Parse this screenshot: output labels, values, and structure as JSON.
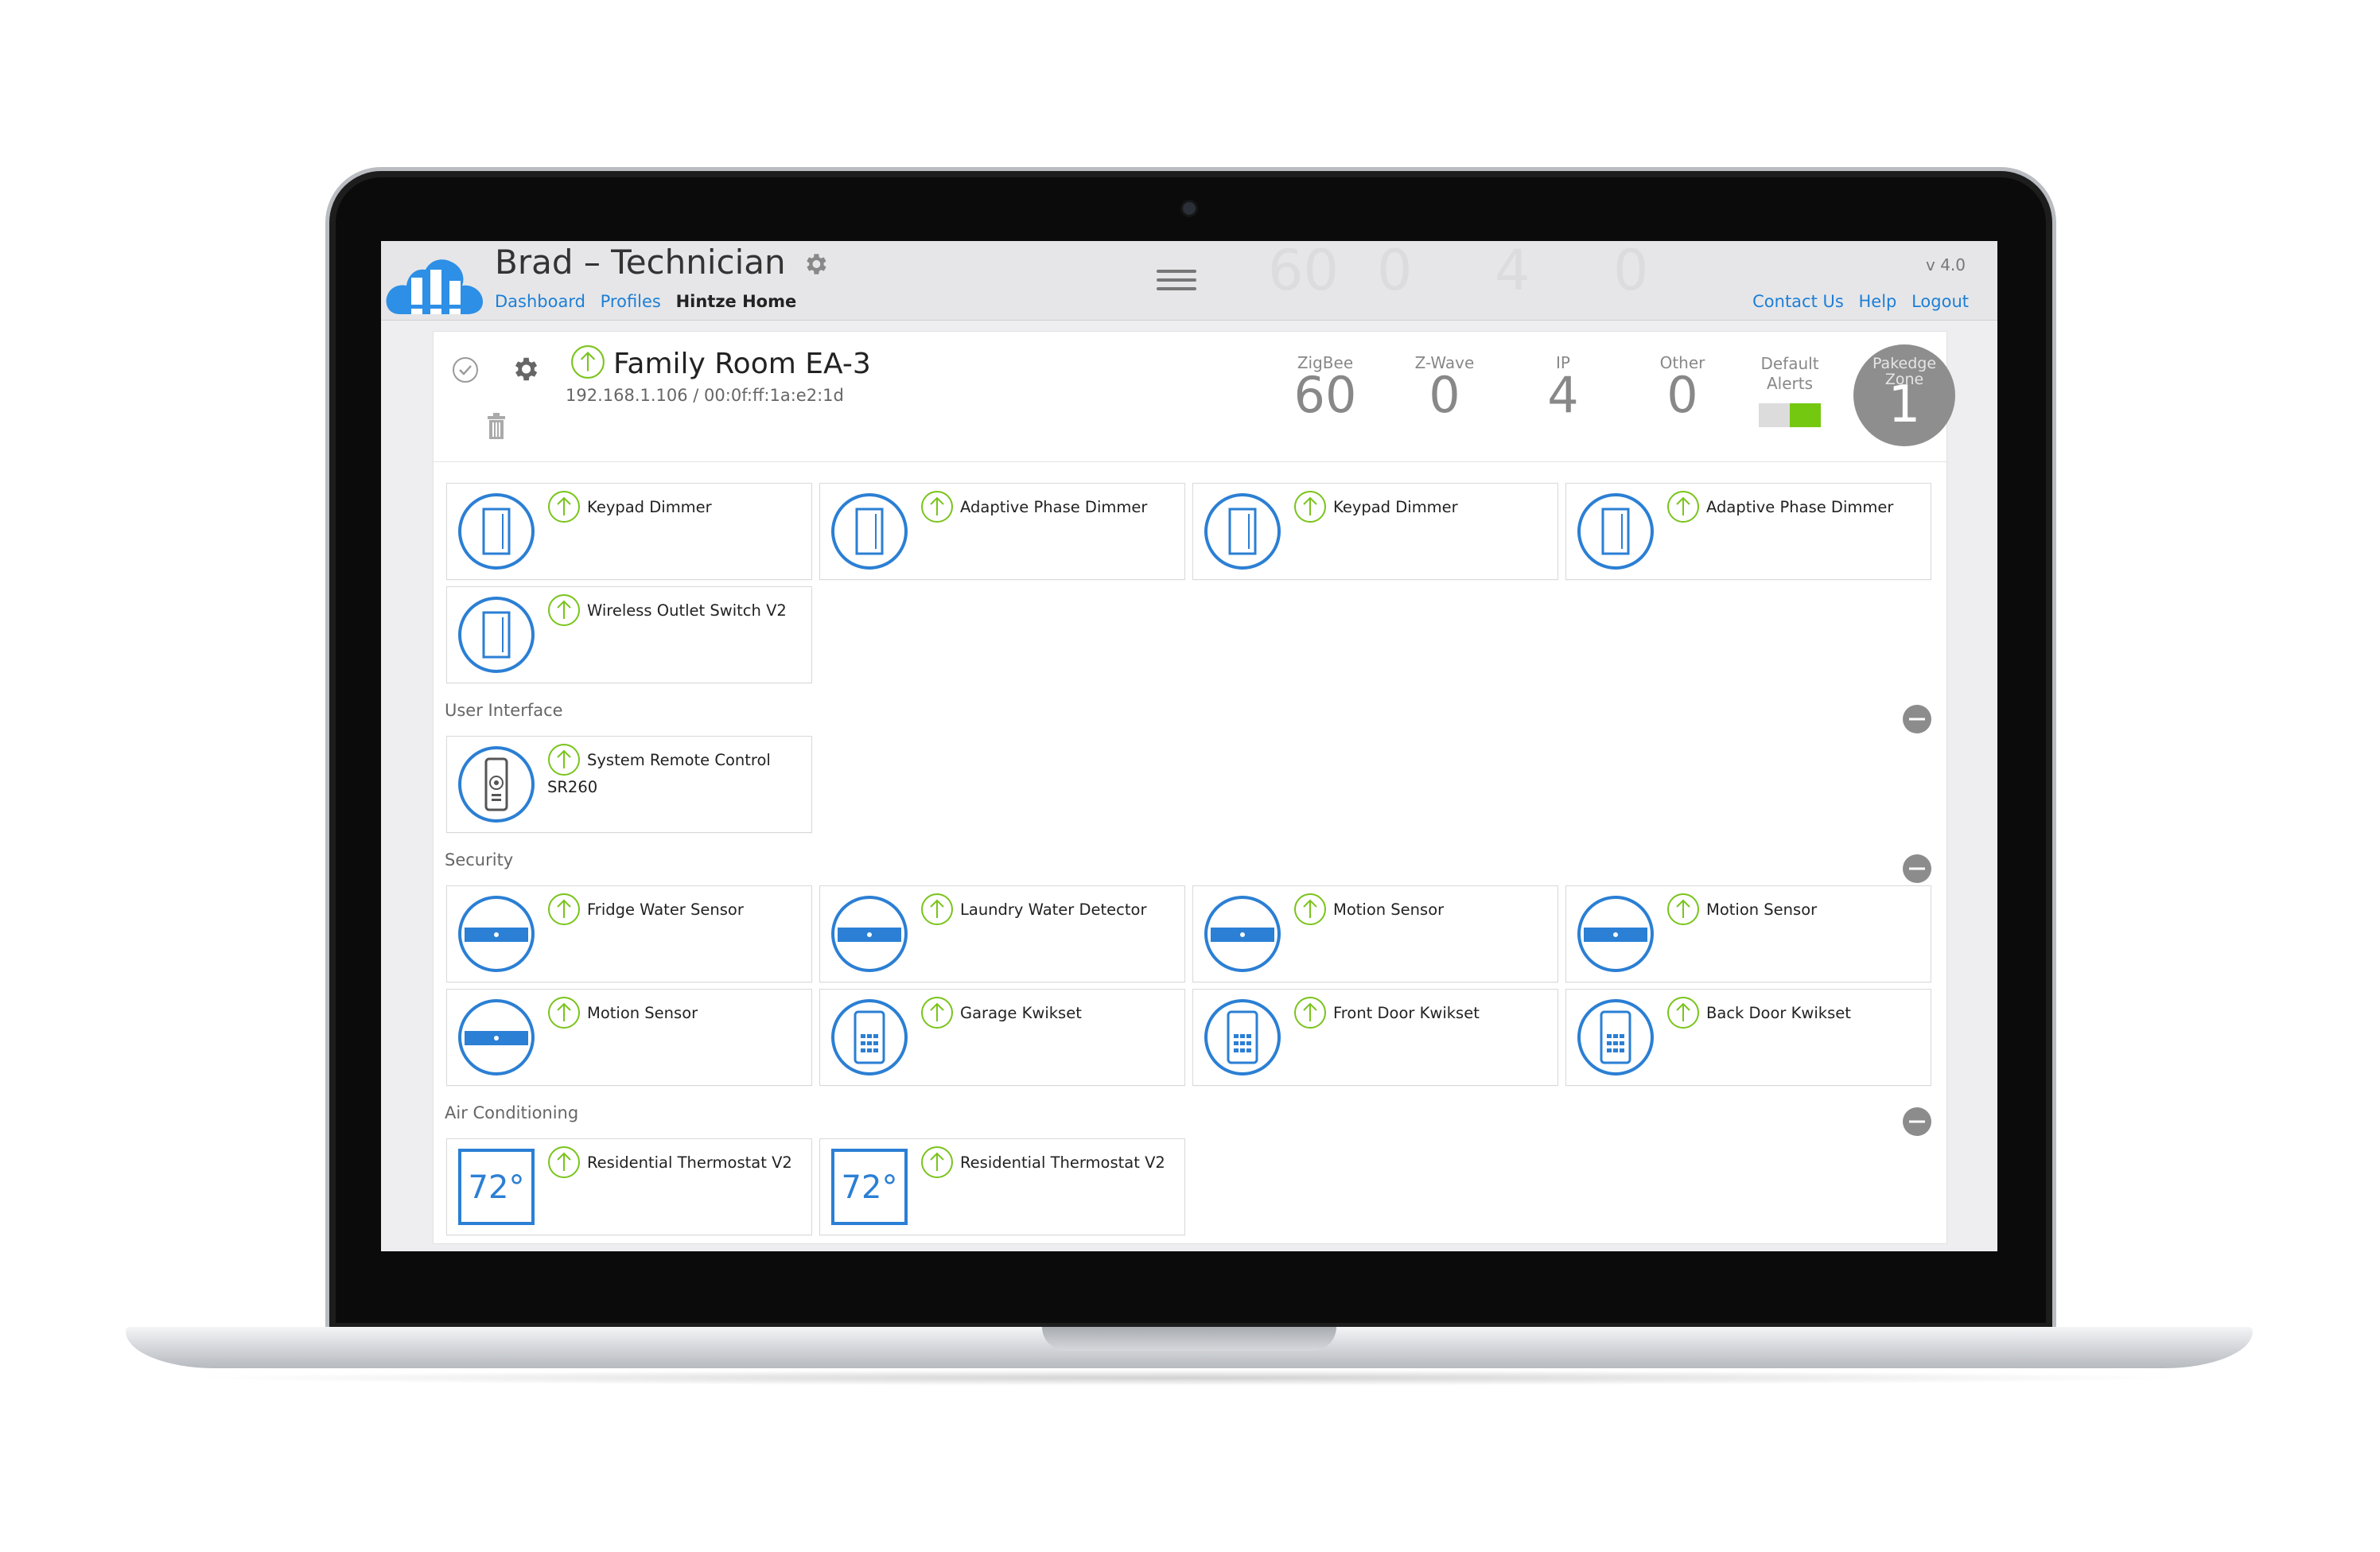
{
  "header": {
    "user_title": "Brad – Technician",
    "nav": [
      "Dashboard",
      "Profiles"
    ],
    "nav_current": "Hintze Home",
    "version": "v 4.0",
    "links": [
      "Contact Us",
      "Help",
      "Logout"
    ]
  },
  "device": {
    "name": "Family Room EA-3",
    "address": "192.168.1.106 / 00:0f:ff:1a:e2:1d",
    "stats": [
      {
        "label": "ZigBee",
        "value": "60"
      },
      {
        "label": "Z-Wave",
        "value": "0"
      },
      {
        "label": "IP",
        "value": "4"
      },
      {
        "label": "Other",
        "value": "0"
      }
    ],
    "alerts_label_1": "Default",
    "alerts_label_2": "Alerts",
    "zone_label_1": "Pakedge",
    "zone_label_2": "Zone",
    "zone_value": "1"
  },
  "cards": [
    "Keypad Dimmer",
    "Adaptive Phase Dimmer",
    "Keypad Dimmer",
    "Adaptive Phase Dimmer",
    "Wireless Outlet Switch V2"
  ],
  "sections": [
    {
      "label": "User Interface",
      "cards": [
        "System Remote Control SR260"
      ]
    },
    {
      "label": "Security",
      "cards": [
        "Fridge Water Sensor",
        "Laundry Water Detector",
        "Motion Sensor",
        "Motion Sensor",
        "Motion Sensor",
        "Garage Kwikset",
        "Front Door Kwikset",
        "Back Door Kwikset"
      ]
    },
    {
      "label": "Air Conditioning",
      "cards": [
        "Residential Thermostat V2",
        "Residential Thermostat V2"
      ],
      "thermostat_value": "72°"
    }
  ],
  "colors": {
    "accent_blue": "#1d7fd6",
    "status_green": "#74c80f"
  }
}
